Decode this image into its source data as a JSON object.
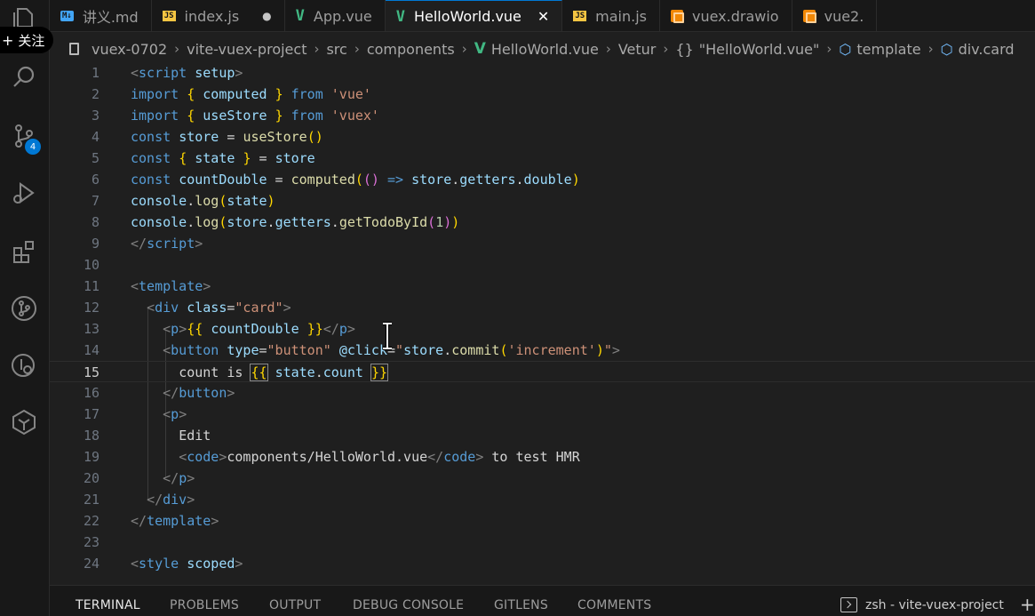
{
  "follow_button": {
    "label": "关注"
  },
  "tabs": [
    {
      "label": "讲义.md",
      "icon": "markdown-file-icon",
      "icon_text": "M↓"
    },
    {
      "label": "index.js",
      "icon": "js-file-icon",
      "icon_text": "JS",
      "unsaved": true
    },
    {
      "label": "App.vue",
      "icon": "vue-file-icon",
      "icon_text": "V"
    },
    {
      "label": "HelloWorld.vue",
      "icon": "vue-file-icon",
      "icon_text": "V",
      "active": true
    },
    {
      "label": "main.js",
      "icon": "js-file-icon",
      "icon_text": "JS"
    },
    {
      "label": "vuex.drawio",
      "icon": "drawio-file-icon"
    },
    {
      "label": "vue2.",
      "icon": "drawio-file-icon"
    }
  ],
  "breadcrumb": [
    "vuex-0702",
    "vite-vuex-project",
    "src",
    "components",
    "HelloWorld.vue",
    "Vetur",
    "\"HelloWorld.vue\"",
    "template",
    "div.card"
  ],
  "breadcrumb_icons": {
    "vetur_icon_text": "{}"
  },
  "source_control_badge": "4",
  "editor": {
    "current_line": 15,
    "lines": [
      [
        [
          "<",
          "t-tag"
        ],
        [
          "script",
          "t-tagname"
        ],
        [
          " ",
          "t-plain"
        ],
        [
          "setup",
          "t-attr"
        ],
        [
          ">",
          "t-tag"
        ]
      ],
      [
        [
          "import",
          "t-kw"
        ],
        [
          " ",
          "t-plain"
        ],
        [
          "{",
          "t-b1"
        ],
        [
          " ",
          "t-plain"
        ],
        [
          "computed",
          "t-var"
        ],
        [
          " ",
          "t-plain"
        ],
        [
          "}",
          "t-b1"
        ],
        [
          " ",
          "t-plain"
        ],
        [
          "from",
          "t-kw"
        ],
        [
          " ",
          "t-plain"
        ],
        [
          "'vue'",
          "t-str"
        ]
      ],
      [
        [
          "import",
          "t-kw"
        ],
        [
          " ",
          "t-plain"
        ],
        [
          "{",
          "t-b1"
        ],
        [
          " ",
          "t-plain"
        ],
        [
          "useStore",
          "t-var"
        ],
        [
          " ",
          "t-plain"
        ],
        [
          "}",
          "t-b1"
        ],
        [
          " ",
          "t-plain"
        ],
        [
          "from",
          "t-kw"
        ],
        [
          " ",
          "t-plain"
        ],
        [
          "'vuex'",
          "t-str"
        ]
      ],
      [
        [
          "const",
          "t-kw"
        ],
        [
          " ",
          "t-plain"
        ],
        [
          "store",
          "t-var"
        ],
        [
          " = ",
          "t-plain"
        ],
        [
          "useStore",
          "t-fn"
        ],
        [
          "()",
          "t-b1"
        ]
      ],
      [
        [
          "const",
          "t-kw"
        ],
        [
          " ",
          "t-plain"
        ],
        [
          "{",
          "t-b1"
        ],
        [
          " ",
          "t-plain"
        ],
        [
          "state",
          "t-var"
        ],
        [
          " ",
          "t-plain"
        ],
        [
          "}",
          "t-b1"
        ],
        [
          " = ",
          "t-plain"
        ],
        [
          "store",
          "t-var"
        ]
      ],
      [
        [
          "const",
          "t-kw"
        ],
        [
          " ",
          "t-plain"
        ],
        [
          "countDouble",
          "t-var"
        ],
        [
          " = ",
          "t-plain"
        ],
        [
          "computed",
          "t-fn"
        ],
        [
          "(",
          "t-b1"
        ],
        [
          "()",
          "t-b2"
        ],
        [
          " ",
          "t-plain"
        ],
        [
          "=>",
          "t-kw"
        ],
        [
          " ",
          "t-plain"
        ],
        [
          "store",
          "t-var"
        ],
        [
          ".",
          "t-plain"
        ],
        [
          "getters",
          "t-var"
        ],
        [
          ".",
          "t-plain"
        ],
        [
          "double",
          "t-var"
        ],
        [
          ")",
          "t-b1"
        ]
      ],
      [
        [
          "console",
          "t-var"
        ],
        [
          ".",
          "t-plain"
        ],
        [
          "log",
          "t-fn"
        ],
        [
          "(",
          "t-b1"
        ],
        [
          "state",
          "t-var"
        ],
        [
          ")",
          "t-b1"
        ]
      ],
      [
        [
          "console",
          "t-var"
        ],
        [
          ".",
          "t-plain"
        ],
        [
          "log",
          "t-fn"
        ],
        [
          "(",
          "t-b1"
        ],
        [
          "store",
          "t-var"
        ],
        [
          ".",
          "t-plain"
        ],
        [
          "getters",
          "t-var"
        ],
        [
          ".",
          "t-plain"
        ],
        [
          "getTodoById",
          "t-fn"
        ],
        [
          "(",
          "t-b2"
        ],
        [
          "1",
          "t-num"
        ],
        [
          ")",
          "t-b2"
        ],
        [
          ")",
          "t-b1"
        ]
      ],
      [
        [
          "</",
          "t-tag"
        ],
        [
          "script",
          "t-tagname"
        ],
        [
          ">",
          "t-tag"
        ]
      ],
      [],
      [
        [
          "<",
          "t-tag"
        ],
        [
          "template",
          "t-tagname"
        ],
        [
          ">",
          "t-tag"
        ]
      ],
      [
        [
          "  ",
          "t-plain"
        ],
        [
          "<",
          "t-tag"
        ],
        [
          "div",
          "t-tagname"
        ],
        [
          " ",
          "t-plain"
        ],
        [
          "class",
          "t-attr"
        ],
        [
          "=",
          "t-plain"
        ],
        [
          "\"card\"",
          "t-str"
        ],
        [
          ">",
          "t-tag"
        ]
      ],
      [
        [
          "    ",
          "t-plain"
        ],
        [
          "<",
          "t-tag"
        ],
        [
          "p",
          "t-tagname"
        ],
        [
          ">",
          "t-tag"
        ],
        [
          "{{",
          "t-b1"
        ],
        [
          " ",
          "t-plain"
        ],
        [
          "countDouble",
          "t-var"
        ],
        [
          " ",
          "t-plain"
        ],
        [
          "}}",
          "t-b1"
        ],
        [
          "</",
          "t-tag"
        ],
        [
          "p",
          "t-tagname"
        ],
        [
          ">",
          "t-tag"
        ]
      ],
      [
        [
          "    ",
          "t-plain"
        ],
        [
          "<",
          "t-tag"
        ],
        [
          "button",
          "t-tagname"
        ],
        [
          " ",
          "t-plain"
        ],
        [
          "type",
          "t-attr"
        ],
        [
          "=",
          "t-plain"
        ],
        [
          "\"button\"",
          "t-str"
        ],
        [
          " ",
          "t-plain"
        ],
        [
          "@click",
          "t-attr"
        ],
        [
          "=",
          "t-plain"
        ],
        [
          "\"",
          "t-str"
        ],
        [
          "store",
          "t-var"
        ],
        [
          ".",
          "t-plain"
        ],
        [
          "commit",
          "t-fn"
        ],
        [
          "(",
          "t-b1"
        ],
        [
          "'increment'",
          "t-str"
        ],
        [
          ")",
          "t-b1"
        ],
        [
          "\"",
          "t-str"
        ],
        [
          ">",
          "t-tag"
        ]
      ],
      [
        [
          "      ",
          "t-plain"
        ],
        [
          "count is ",
          "t-plain"
        ],
        [
          "{{",
          "t-b1 t-bhl"
        ],
        [
          " ",
          "t-plain"
        ],
        [
          "state",
          "t-var"
        ],
        [
          ".",
          "t-plain"
        ],
        [
          "count",
          "t-var"
        ],
        [
          " ",
          "t-plain"
        ],
        [
          "}}",
          "t-b1 t-bhl"
        ]
      ],
      [
        [
          "    ",
          "t-plain"
        ],
        [
          "</",
          "t-tag"
        ],
        [
          "button",
          "t-tagname"
        ],
        [
          ">",
          "t-tag"
        ]
      ],
      [
        [
          "    ",
          "t-plain"
        ],
        [
          "<",
          "t-tag"
        ],
        [
          "p",
          "t-tagname"
        ],
        [
          ">",
          "t-tag"
        ]
      ],
      [
        [
          "      ",
          "t-plain"
        ],
        [
          "Edit",
          "t-plain"
        ]
      ],
      [
        [
          "      ",
          "t-plain"
        ],
        [
          "<",
          "t-tag"
        ],
        [
          "code",
          "t-tagname"
        ],
        [
          ">",
          "t-tag"
        ],
        [
          "components/HelloWorld.vue",
          "t-plain"
        ],
        [
          "</",
          "t-tag"
        ],
        [
          "code",
          "t-tagname"
        ],
        [
          ">",
          "t-tag"
        ],
        [
          " to test HMR",
          "t-plain"
        ]
      ],
      [
        [
          "    ",
          "t-plain"
        ],
        [
          "</",
          "t-tag"
        ],
        [
          "p",
          "t-tagname"
        ],
        [
          ">",
          "t-tag"
        ]
      ],
      [
        [
          "  ",
          "t-plain"
        ],
        [
          "</",
          "t-tag"
        ],
        [
          "div",
          "t-tagname"
        ],
        [
          ">",
          "t-tag"
        ]
      ],
      [
        [
          "</",
          "t-tag"
        ],
        [
          "template",
          "t-tagname"
        ],
        [
          ">",
          "t-tag"
        ]
      ],
      [],
      [
        [
          "<",
          "t-tag"
        ],
        [
          "style",
          "t-tagname"
        ],
        [
          " ",
          "t-plain"
        ],
        [
          "scoped",
          "t-attr"
        ],
        [
          ">",
          "t-tag"
        ]
      ]
    ]
  },
  "panel": {
    "tabs": [
      "TERMINAL",
      "PROBLEMS",
      "OUTPUT",
      "DEBUG CONSOLE",
      "GITLENS",
      "COMMENTS"
    ],
    "active_tab": "TERMINAL",
    "terminal_name": "zsh - vite-vuex-project",
    "add_label": "+"
  },
  "colors": {
    "accent": "#0078d4",
    "vue": "#41b883",
    "editor_bg": "#1f1f1f",
    "sidebar_bg": "#181818"
  }
}
